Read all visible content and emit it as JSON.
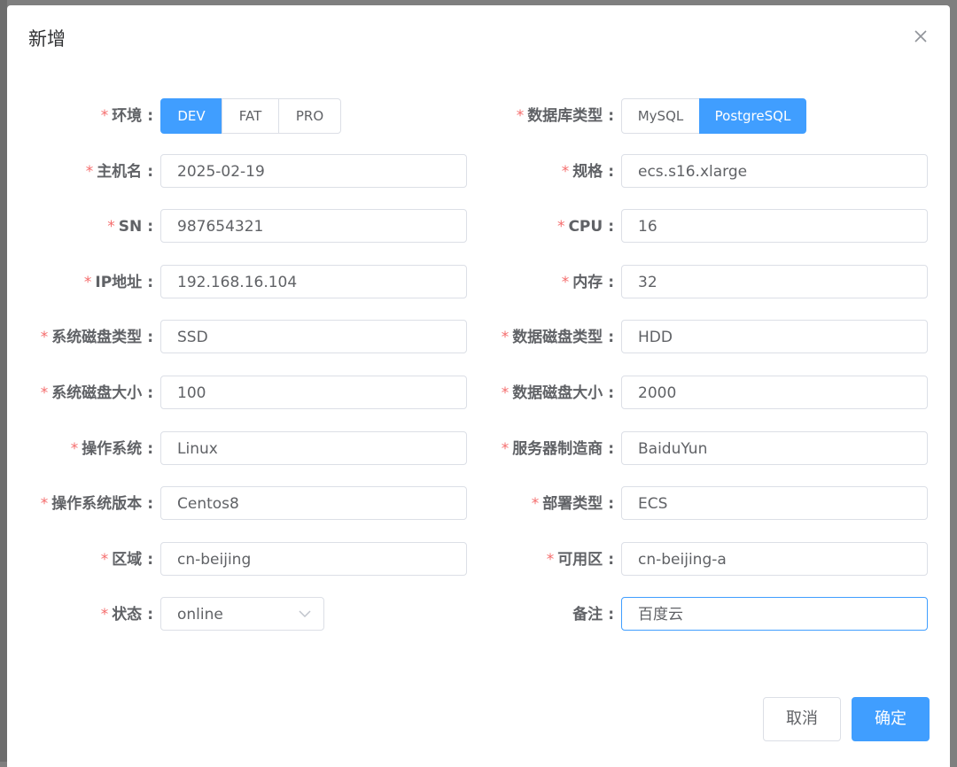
{
  "dialog": {
    "title": "新增",
    "close_icon": "close-icon",
    "required_mark": "*",
    "colon": ":"
  },
  "form": {
    "left": [
      {
        "key": "env",
        "label": "环境",
        "type": "segmented",
        "options": [
          "DEV",
          "FAT",
          "PRO"
        ],
        "selected": "DEV",
        "required": true
      },
      {
        "key": "hostname",
        "label": "主机名",
        "value": "2025-02-19",
        "required": true
      },
      {
        "key": "sn",
        "label": "SN",
        "value": "987654321",
        "required": true
      },
      {
        "key": "ip",
        "label": "IP地址",
        "value": "192.168.16.104",
        "required": true
      },
      {
        "key": "sys_disk_type",
        "label": "系统磁盘类型",
        "value": "SSD",
        "required": true
      },
      {
        "key": "sys_disk_size",
        "label": "系统磁盘大小",
        "value": "100",
        "required": true
      },
      {
        "key": "os",
        "label": "操作系统",
        "value": "Linux",
        "required": true
      },
      {
        "key": "os_version",
        "label": "操作系统版本",
        "value": "Centos8",
        "required": true
      },
      {
        "key": "region",
        "label": "区域",
        "value": "cn-beijing",
        "required": true
      },
      {
        "key": "status",
        "label": "状态",
        "type": "select",
        "value": "online",
        "required": true
      }
    ],
    "right": [
      {
        "key": "db_type",
        "label": "数据库类型",
        "type": "segmented",
        "options": [
          "MySQL",
          "PostgreSQL"
        ],
        "selected": "PostgreSQL",
        "required": true
      },
      {
        "key": "spec",
        "label": "规格",
        "value": "ecs.s16.xlarge",
        "required": true
      },
      {
        "key": "cpu",
        "label": "CPU",
        "value": "16",
        "required": true
      },
      {
        "key": "memory",
        "label": "内存",
        "value": "32",
        "required": true
      },
      {
        "key": "data_disk_type",
        "label": "数据磁盘类型",
        "value": "HDD",
        "required": true
      },
      {
        "key": "data_disk_size",
        "label": "数据磁盘大小",
        "value": "2000",
        "required": true
      },
      {
        "key": "vendor",
        "label": "服务器制造商",
        "value": "BaiduYun",
        "required": true
      },
      {
        "key": "deploy_type",
        "label": "部署类型",
        "value": "ECS",
        "required": true
      },
      {
        "key": "zone",
        "label": "可用区",
        "value": "cn-beijing-a",
        "required": true
      },
      {
        "key": "remark",
        "label": "备注",
        "value": "百度云",
        "required": false,
        "focused": true
      }
    ]
  },
  "footer": {
    "cancel_label": "取消",
    "confirm_label": "确定"
  },
  "colors": {
    "primary": "#409eff",
    "required": "#f56c6c",
    "text": "#606266",
    "border": "#dcdfe6"
  }
}
